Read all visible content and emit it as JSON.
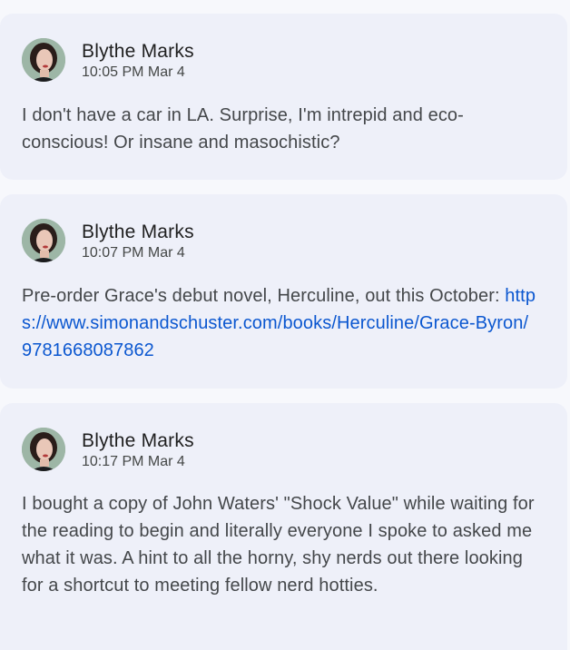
{
  "posts": [
    {
      "author": "Blythe Marks",
      "time": "10:05 PM Mar 4",
      "text": "I don't have a car in LA. Surprise, I'm intrepid and eco-conscious! Or insane and masochistic?"
    },
    {
      "author": "Blythe Marks",
      "time": "10:07 PM Mar 4",
      "text": "Pre-order Grace's debut novel, Herculine, out this October: ",
      "link": "https://www.simonandschuster.com/books/Herculine/Grace-Byron/9781668087862"
    },
    {
      "author": "Blythe Marks",
      "time": "10:17 PM Mar 4",
      "text": "I bought a copy of John Waters' \"Shock Value\" while waiting for the reading to begin and literally everyone I spoke to asked me what it was. A hint to all the horny, shy nerds out there looking for a shortcut to meeting fellow nerd hotties."
    }
  ],
  "colors": {
    "card_bg": "#eef0f9",
    "page_bg": "#f7f8fc",
    "link": "#0b57d0",
    "author": "#1f1f1f",
    "body_text": "#44474a"
  },
  "icons": {
    "avatar": "avatar-photo"
  }
}
